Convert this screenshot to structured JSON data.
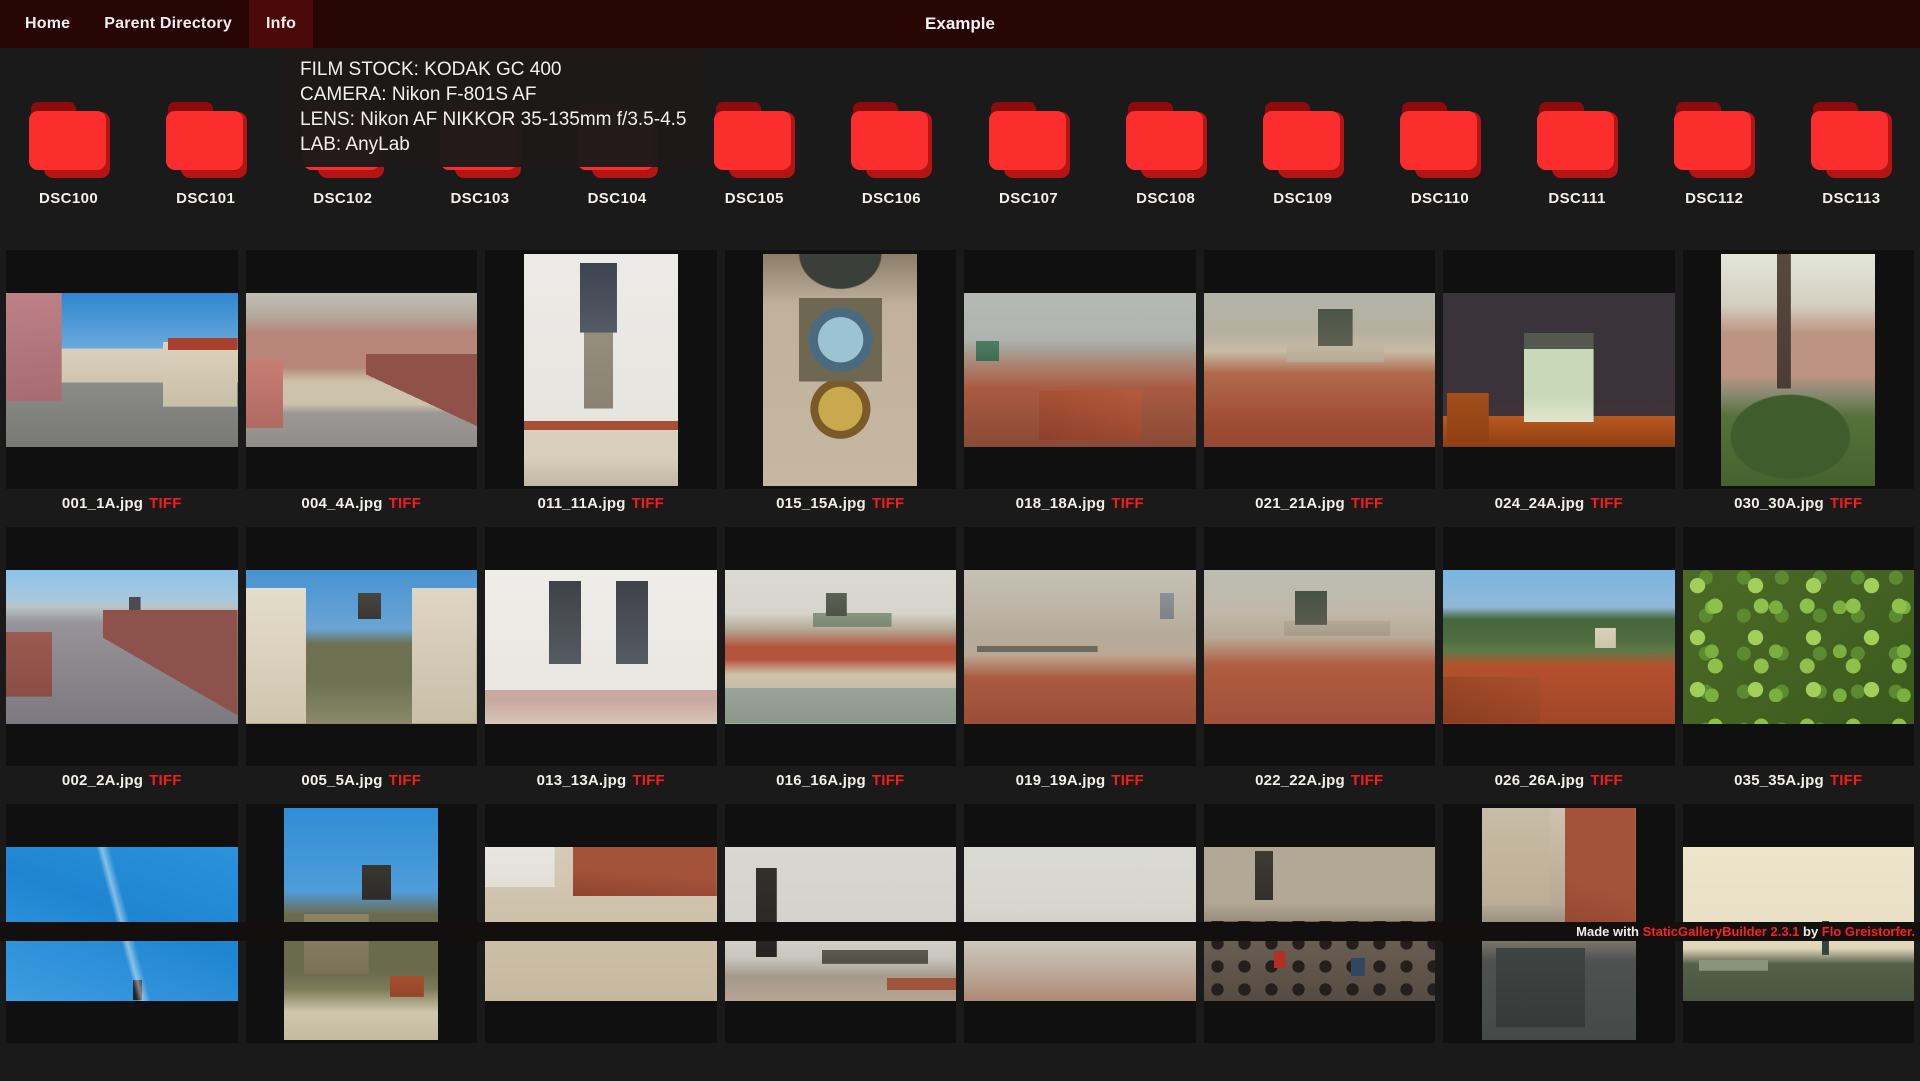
{
  "nav": {
    "items": [
      {
        "label": "Home",
        "active": false
      },
      {
        "label": "Parent Directory",
        "active": false
      },
      {
        "label": "Info",
        "active": true
      }
    ],
    "title": "Example"
  },
  "tooltip": {
    "lines": [
      "FILM STOCK: KODAK GC 400",
      "CAMERA: Nikon F-801S AF",
      "LENS: Nikon AF NIKKOR 35-135mm f/3.5-4.5",
      "LAB: AnyLab"
    ]
  },
  "folders": {
    "items": [
      {
        "label": "DSC100"
      },
      {
        "label": "DSC101"
      },
      {
        "label": "DSC102"
      },
      {
        "label": "DSC103"
      },
      {
        "label": "DSC104"
      },
      {
        "label": "DSC105"
      },
      {
        "label": "DSC106"
      },
      {
        "label": "DSC107"
      },
      {
        "label": "DSC108"
      },
      {
        "label": "DSC109"
      },
      {
        "label": "DSC110"
      },
      {
        "label": "DSC111"
      },
      {
        "label": "DSC112"
      },
      {
        "label": "DSC113"
      }
    ]
  },
  "gallery": {
    "items": [
      {
        "filename": "001_1A.jpg",
        "badge": "TIFF",
        "visual": "street",
        "orientation": "landscape"
      },
      {
        "filename": "004_4A.jpg",
        "badge": "TIFF",
        "visual": "rooftop-street",
        "orientation": "landscape"
      },
      {
        "filename": "011_11A.jpg",
        "badge": "TIFF",
        "visual": "town-hall-tower",
        "orientation": "portrait"
      },
      {
        "filename": "015_15A.jpg",
        "badge": "TIFF",
        "visual": "astronomical-clock",
        "orientation": "portrait"
      },
      {
        "filename": "018_18A.jpg",
        "badge": "TIFF",
        "visual": "red-roofs-view",
        "orientation": "landscape"
      },
      {
        "filename": "021_21A.jpg",
        "badge": "TIFF",
        "visual": "castle-view",
        "orientation": "landscape"
      },
      {
        "filename": "024_24A.jpg",
        "badge": "TIFF",
        "visual": "night-church",
        "orientation": "landscape"
      },
      {
        "filename": "030_30A.jpg",
        "badge": "TIFF",
        "visual": "city-through-trees",
        "orientation": "portrait"
      },
      {
        "filename": "002_2A.jpg",
        "badge": "TIFF",
        "visual": "rooftop-square",
        "orientation": "landscape"
      },
      {
        "filename": "005_5A.jpg",
        "badge": "TIFF",
        "visual": "hillside-tower",
        "orientation": "landscape"
      },
      {
        "filename": "013_13A.jpg",
        "badge": "TIFF",
        "visual": "tyn-church",
        "orientation": "landscape"
      },
      {
        "filename": "016_16A.jpg",
        "badge": "TIFF",
        "visual": "riverside",
        "orientation": "landscape"
      },
      {
        "filename": "019_19A.jpg",
        "badge": "TIFF",
        "visual": "river-panorama",
        "orientation": "landscape"
      },
      {
        "filename": "022_22A.jpg",
        "badge": "TIFF",
        "visual": "cathedral-panorama",
        "orientation": "landscape"
      },
      {
        "filename": "026_26A.jpg",
        "badge": "TIFF",
        "visual": "roofs-mountain",
        "orientation": "landscape"
      },
      {
        "filename": "035_35A.jpg",
        "badge": "TIFF",
        "visual": "foliage",
        "orientation": "landscape"
      },
      {
        "filename": "",
        "badge": "",
        "visual": "blue-sky",
        "orientation": "landscape"
      },
      {
        "filename": "",
        "badge": "",
        "visual": "clocktower-hill",
        "orientation": "portrait"
      },
      {
        "filename": "",
        "badge": "",
        "visual": "ornate-facades",
        "orientation": "landscape"
      },
      {
        "filename": "",
        "badge": "",
        "visual": "bridge-statue",
        "orientation": "landscape"
      },
      {
        "filename": "",
        "badge": "",
        "visual": "hazy-panorama",
        "orientation": "landscape"
      },
      {
        "filename": "",
        "badge": "",
        "visual": "crowd",
        "orientation": "landscape"
      },
      {
        "filename": "",
        "badge": "",
        "visual": "street-from-above",
        "orientation": "portrait"
      },
      {
        "filename": "",
        "badge": "",
        "visual": "pale-panorama",
        "orientation": "landscape"
      }
    ]
  },
  "footer": {
    "prefix": "Made with ",
    "builder": "StaticGalleryBuilder 2.3.1",
    "middle": " by ",
    "author": "Flo Greistorfer."
  },
  "colors": {
    "nav_bg": "#270505",
    "nav_active_bg": "#4c0909",
    "page_bg": "#1a1a1a",
    "tile_bg": "#101010",
    "folder_red": "#fb2d2d",
    "folder_red_dark": "#8e0b0b",
    "badge_red": "#f21d1d",
    "footer_link_red": "#f42222"
  }
}
